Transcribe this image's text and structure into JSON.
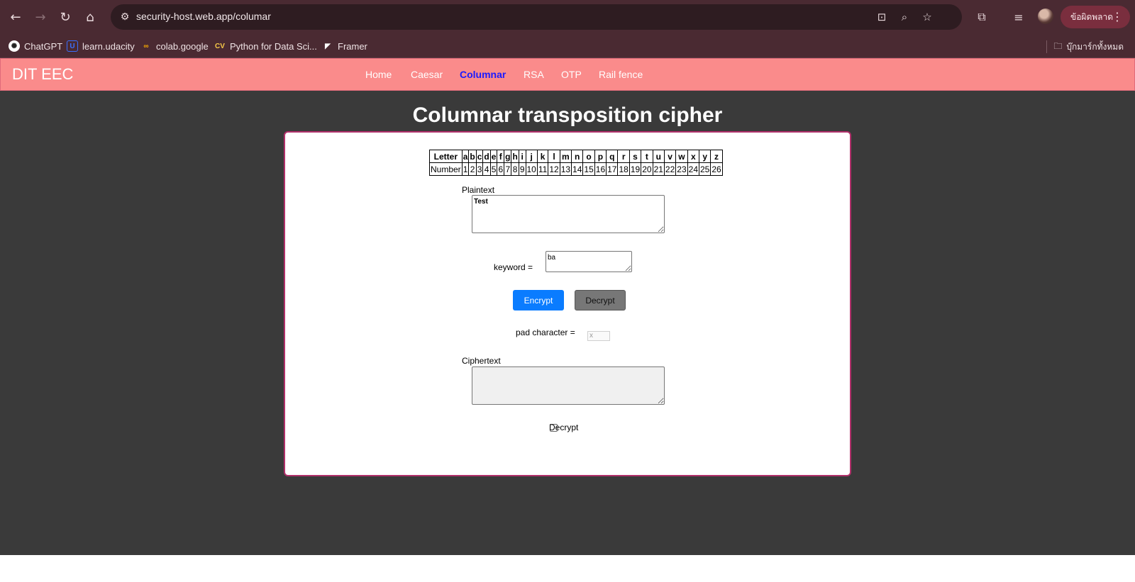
{
  "browser": {
    "url": "security-host.web.app/columar",
    "error_label": "ข้อผิดพลาด",
    "bookmarks": [
      "ChatGPT",
      "learn.udacity",
      "colab.google",
      "Python for Data Sci...",
      "Framer"
    ],
    "all_bookmarks_label": "บุ๊กมาร์กทั้งหมด"
  },
  "navbar": {
    "brand": "DIT EEC",
    "links": [
      "Home",
      "Caesar",
      "Columnar",
      "RSA",
      "OTP",
      "Rail fence"
    ],
    "active": "Columnar"
  },
  "page": {
    "title": "Columnar transposition cipher"
  },
  "table": {
    "letter_header": "Letter",
    "number_header": "Number",
    "letters": [
      "a",
      "b",
      "c",
      "d",
      "e",
      "f",
      "g",
      "h",
      "i",
      "j",
      "k",
      "l",
      "m",
      "n",
      "o",
      "p",
      "q",
      "r",
      "s",
      "t",
      "u",
      "v",
      "w",
      "x",
      "y",
      "z"
    ],
    "numbers": [
      "1",
      "2",
      "3",
      "4",
      "5",
      "6",
      "7",
      "8",
      "9",
      "10",
      "11",
      "12",
      "13",
      "14",
      "15",
      "16",
      "17",
      "18",
      "19",
      "20",
      "21",
      "22",
      "23",
      "24",
      "25",
      "26"
    ]
  },
  "form": {
    "plaintext_label": "Plaintext",
    "plaintext_value": "Test",
    "keyword_label": "keyword =",
    "keyword_value": "ba",
    "encrypt_label": "Encrypt",
    "decrypt_label": "Decrypt",
    "pad_label": "pad character =",
    "pad_placeholder": "x",
    "ciphertext_label": "Ciphertext",
    "ciphertext_value": "",
    "decrypt_checkbox_label": "Decrypt"
  }
}
